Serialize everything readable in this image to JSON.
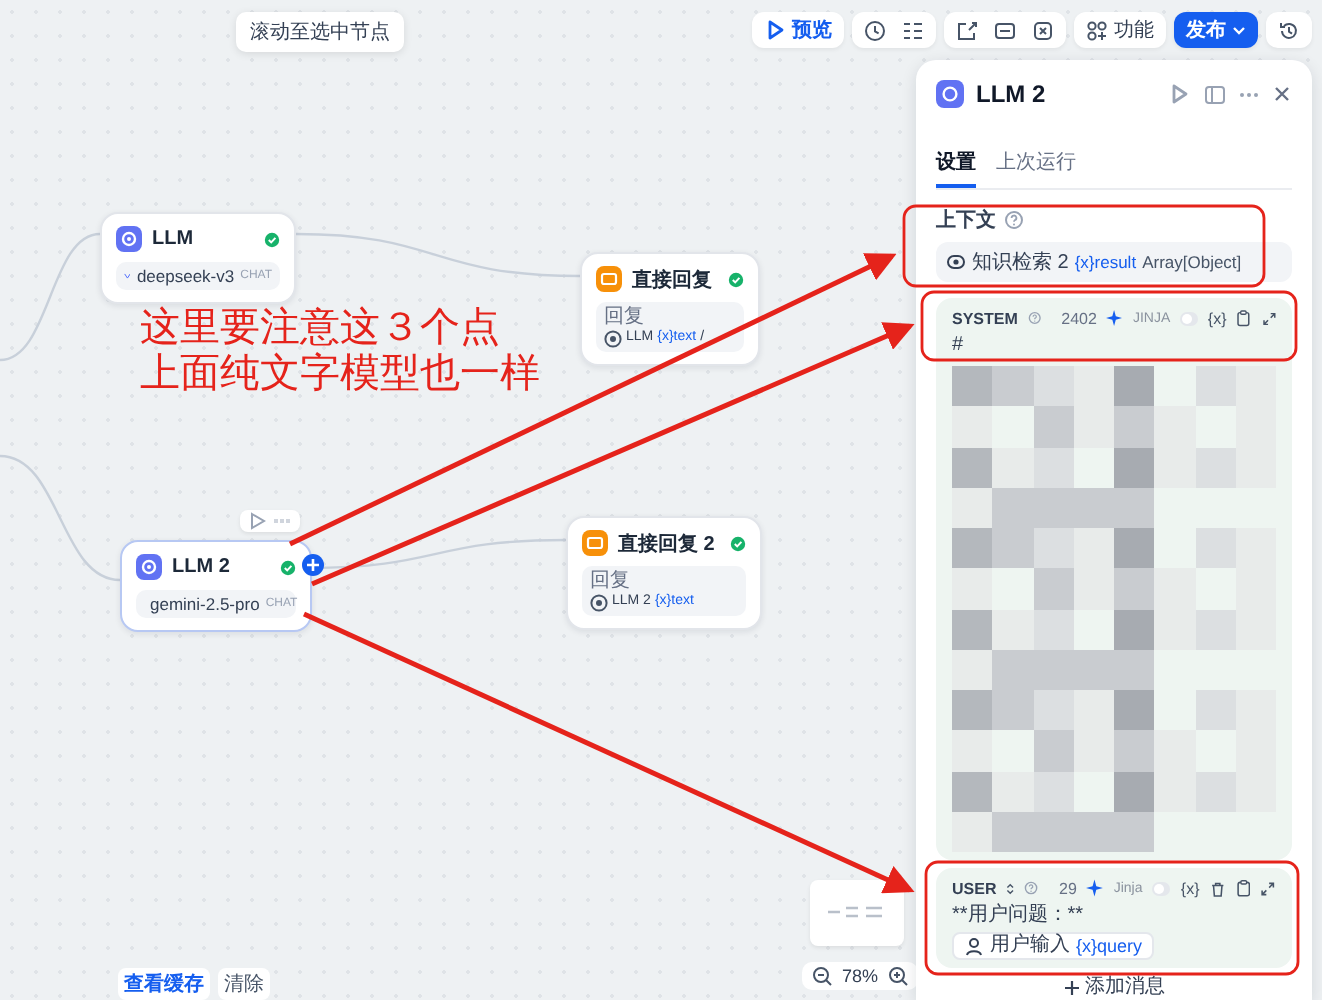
{
  "toolbar": {
    "tooltip": "滚动至选中节点",
    "preview_button": "预览",
    "features_button": "功能",
    "publish_button": "发布"
  },
  "canvas": {
    "nodes": [
      {
        "kind": "llm",
        "title": "LLM",
        "model": "deepseek-v3",
        "mode": "CHAT",
        "succeeded": true,
        "selected": false
      },
      {
        "kind": "reply",
        "title": "直接回复",
        "field_label": "回复",
        "source": "LLM",
        "variable": "{x}text",
        "suffix": "/",
        "succeeded": true,
        "selected": false
      },
      {
        "kind": "llm",
        "title": "LLM 2",
        "model": "gemini-2.5-pro",
        "mode": "CHAT",
        "succeeded": true,
        "selected": true
      },
      {
        "kind": "reply",
        "title": "直接回复 2",
        "field_label": "回复",
        "source": "LLM 2",
        "variable": "{x}text",
        "succeeded": true,
        "selected": false
      }
    ],
    "annotation": [
      "这里要注意这３个点",
      "上面纯文字模型也一样"
    ],
    "zoom": "78%",
    "cache_buttons": [
      "查看缓存",
      "清除"
    ]
  },
  "panel": {
    "title": "LLM 2",
    "tabs": [
      {
        "label": "设置",
        "selected": true
      },
      {
        "label": "上次运行",
        "selected": false
      }
    ],
    "context": {
      "label": "上下文",
      "source": "知识检索 2",
      "variable": "{x}result",
      "type": "Array[Object]"
    },
    "messages": [
      {
        "role": "SYSTEM",
        "role_selectable": false,
        "count": "2402",
        "jinja_label": "JINJA",
        "jinja": false,
        "variable_button": "{x}",
        "text": "#",
        "blurred": true
      },
      {
        "role": "USER",
        "role_selectable": true,
        "count": "29",
        "jinja_label": "Jinja",
        "jinja": false,
        "variable_button": "{x}",
        "text": "**用户问题：**",
        "input": "用户输入",
        "variable": "{x}query"
      }
    ],
    "add_message": "添加消息"
  }
}
